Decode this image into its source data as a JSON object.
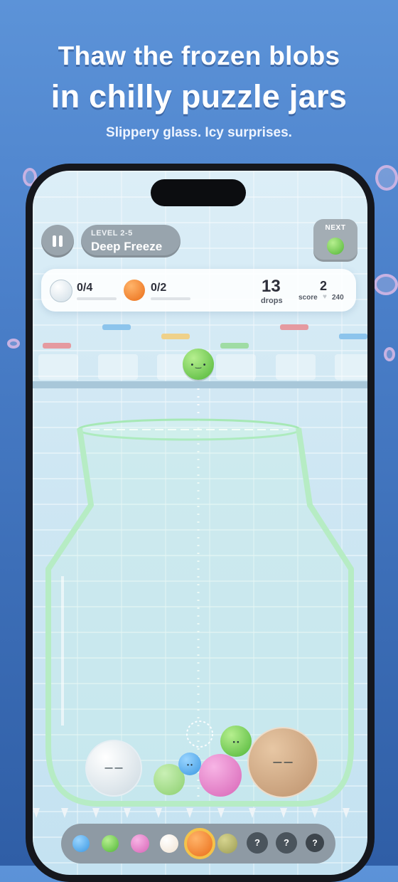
{
  "marketing": {
    "headline_line1": "Thaw the frozen blobs",
    "headline_line2": "in chilly puzzle jars",
    "subtitle": "Slippery glass. Icy surprises."
  },
  "hud": {
    "level_label": "LEVEL 2-5",
    "level_name": "Deep Freeze",
    "next_label": "NEXT",
    "next_blob": "green-blob"
  },
  "goals": [
    {
      "blob": "ice-blob",
      "progress": "0/4"
    },
    {
      "blob": "orange-blob",
      "progress": "0/2"
    }
  ],
  "stats": {
    "drops_value": "13",
    "drops_label": "drops",
    "score_value": "2",
    "score_label": "score",
    "best_value": "240",
    "best_icon": "heart-icon"
  },
  "toolbar": {
    "items": [
      "blue-blob",
      "green-blob",
      "pink-blob",
      "cream-blob",
      "orange-blob",
      "olive-blob",
      "locked",
      "locked",
      "locked-bomb"
    ],
    "locked_label": "?",
    "selected_index": 4
  },
  "colors": {
    "green": "#63c64a",
    "blue": "#4fa6e8",
    "pink": "#e57bc5",
    "orange": "#f07b25",
    "ice": "#d9e6ee",
    "tan": "#c9a17f"
  }
}
